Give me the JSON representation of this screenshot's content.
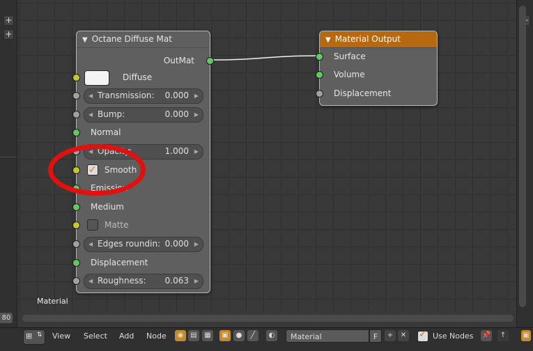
{
  "editor": {
    "material_label": "Material",
    "left_number": "80"
  },
  "node_diffuse": {
    "title": "Octane Diffuse Mat",
    "output_label": "OutMat",
    "diffuse_label": "Diffuse",
    "transmission": {
      "label": "Transmission:",
      "value": "0.000"
    },
    "bump": {
      "label": "Bump:",
      "value": "0.000"
    },
    "normal_label": "Normal",
    "opacity": {
      "label": "Opacity:",
      "value": "1.000"
    },
    "smooth": {
      "label": "Smooth",
      "checked": true
    },
    "emission_label": "Emission",
    "medium_label": "Medium",
    "matte": {
      "label": "Matte",
      "checked": false
    },
    "edges": {
      "label": "Edges roundin:",
      "value": "0.000"
    },
    "displacement_label": "Displacement",
    "roughness": {
      "label": "Roughness:",
      "value": "0.063"
    }
  },
  "node_output": {
    "title": "Material Output",
    "inputs": [
      "Surface",
      "Volume",
      "Displacement"
    ]
  },
  "statusbar": {
    "menu": [
      "View",
      "Select",
      "Add",
      "Node"
    ],
    "material_name": "Material",
    "fake_user": "F",
    "use_nodes_label": "Use Nodes",
    "use_nodes_checked": true
  },
  "colors": {
    "output_header": "#b8680f",
    "socket_green": "#63c763",
    "socket_yellow": "#c7c729",
    "socket_grey": "#a1a1a1",
    "highlight_circle": "#e40f0f"
  }
}
